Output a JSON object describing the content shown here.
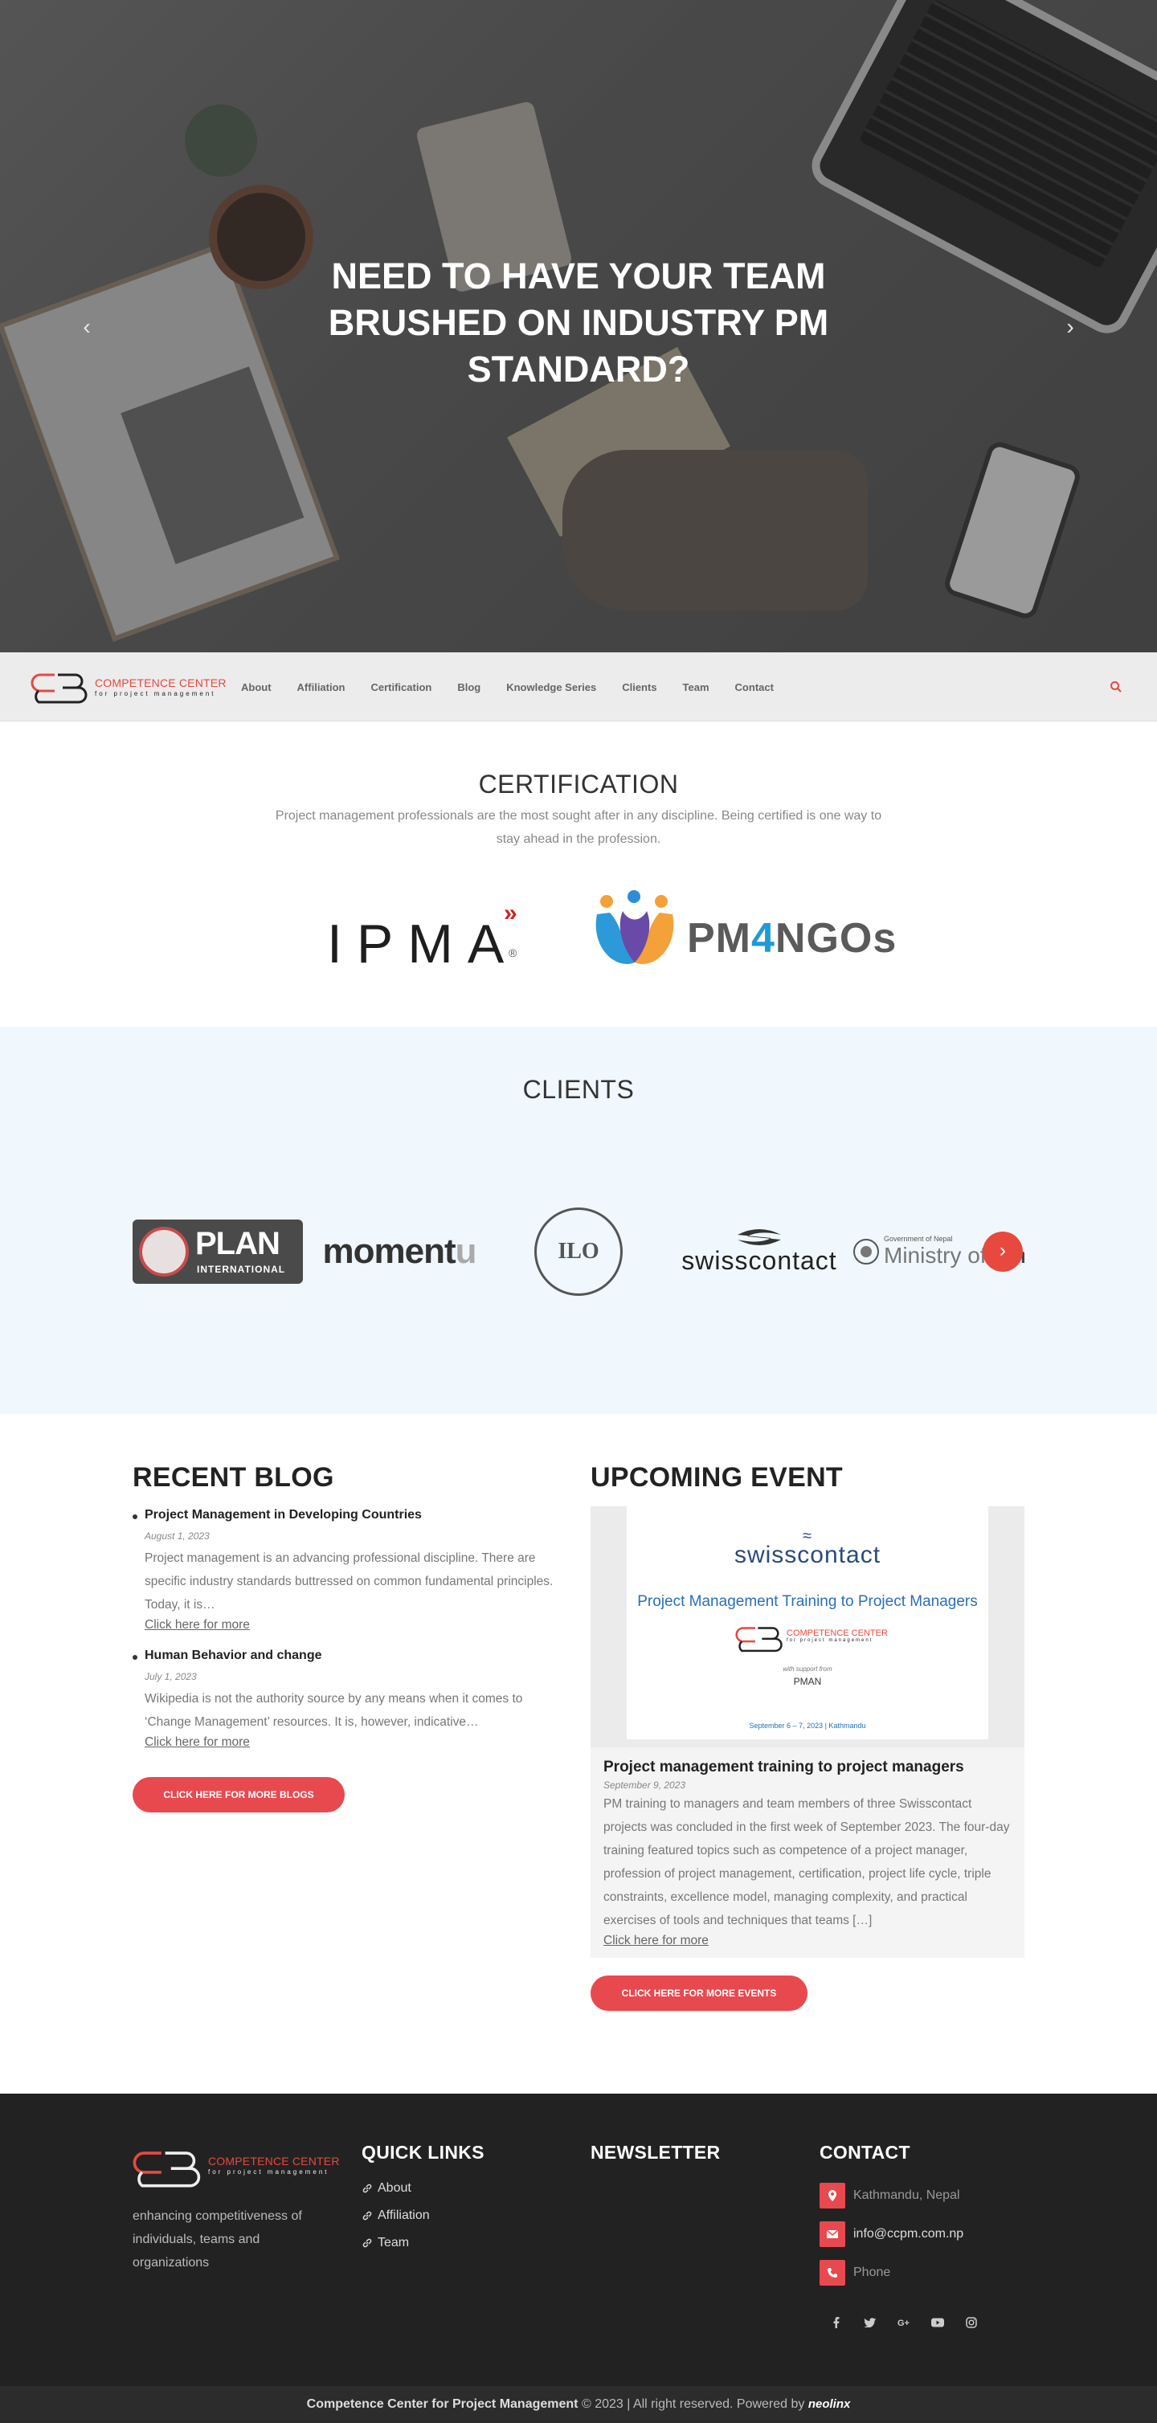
{
  "hero": {
    "headline": "NEED TO HAVE YOUR TEAM BRUSHED ON INDUSTRY PM STANDARD?"
  },
  "brand": {
    "name": "COMPETENCE CENTER",
    "sub": "for project management",
    "accent": "#e8493f"
  },
  "nav": {
    "items": [
      "About",
      "Affiliation",
      "Certification",
      "Blog",
      "Knowledge Series",
      "Clients",
      "Team",
      "Contact"
    ]
  },
  "certification": {
    "title": "CERTIFICATION",
    "description": "Project management professionals are the most sought after in any discipline. Being certified is one way to stay ahead in the profession.",
    "logos": {
      "ipma": "IPMA",
      "ipma_reg": "®",
      "pm4ngos_a": "PM",
      "pm4ngos_b": "4",
      "pm4ngos_c": "NGOs"
    }
  },
  "clients": {
    "title": "CLIENTS",
    "plan": "PLAN",
    "plan_sub": "INTERNATIONAL",
    "momentum_a": "moment",
    "momentum_b": "u",
    "ilo": "ILO",
    "swisscontact": "swisscontact",
    "mof_small": "Government of Nepal",
    "mof_a": "Ministry of ",
    "mof_b": "Finance"
  },
  "blog": {
    "title": "RECENT BLOG",
    "posts": [
      {
        "title": "Project Management in Developing Countries",
        "date": "August 1, 2023",
        "excerpt": "Project management is an advancing professional discipline. There are specific industry standards buttressed on common fundamental principles. Today, it is…",
        "link": "Click here for more"
      },
      {
        "title": "Human Behavior and change",
        "date": "July 1, 2023",
        "excerpt": "Wikipedia is not the authority source by any means when it comes to ‘Change Management’ resources. It is, however, indicative…",
        "link": "Click here for more"
      }
    ],
    "button": "CLICK HERE FOR MORE BLOGS"
  },
  "event": {
    "title": "UPCOMING EVENT",
    "poster": {
      "org": "swisscontact",
      "headline": "Project Management Training to Project Managers",
      "support": "with support from",
      "pman": "PMAN",
      "dates": "September 6 – 7, 2023   |   Kathmandu"
    },
    "card_title": "Project management training to project managers",
    "card_date": "September 9, 2023",
    "excerpt": "PM training to managers and team members of three Swisscontact projects was concluded in the first week of September 2023. The four-day training featured topics such as competence of a project manager, profession of project management, certification, project life cycle, triple constraints, excellence model, managing complexity, and practical exercises of tools and techniques that teams […]",
    "link": "Click here for more",
    "button": "CLICK HERE FOR MORE EVENTS"
  },
  "footer": {
    "tagline": "enhancing competitiveness of individuals, teams and organizations",
    "quick_links_title": "QUICK LINKS",
    "quick_links": [
      "About",
      "Affiliation",
      "Team"
    ],
    "newsletter_title": "NEWSLETTER",
    "contact_title": "CONTACT",
    "contact": {
      "location": "Kathmandu, Nepal",
      "email": "info@ccpm.com.np",
      "phone": "Phone"
    },
    "socials": [
      "facebook-icon",
      "twitter-icon",
      "google-plus-icon",
      "youtube-icon",
      "instagram-icon"
    ]
  },
  "copyright": {
    "org": "Competence Center for Project Management",
    "symbol": "©",
    "text": " 2023 | All right reserved. Powered by ",
    "powered": "neolinx"
  }
}
